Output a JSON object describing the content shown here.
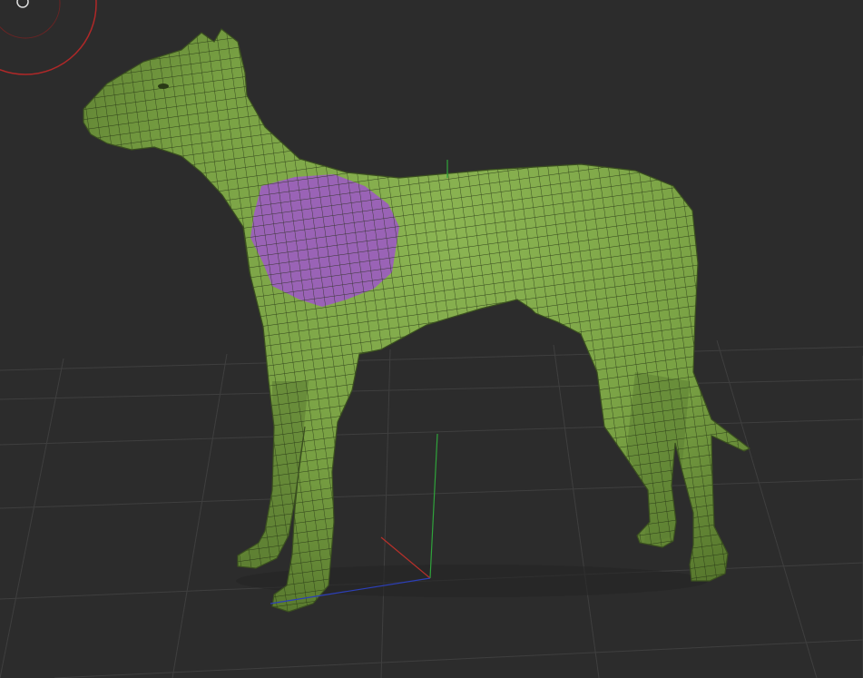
{
  "viewport": {
    "model_name": "dog-mesh",
    "colors": {
      "background": "#2c2c2c",
      "grid": "#3d3d3d",
      "model_fill": "#7fa84a",
      "model_shadow": "#4f6b2b",
      "wireframe": "#1d2a10",
      "polygroup_highlight": "#9a63b6",
      "axis_x": "#b8302a",
      "axis_y": "#2fa33b",
      "axis_z": "#2c3fb8",
      "brush_ring": "#b02828"
    },
    "gizmo": {
      "axes": [
        "x",
        "y",
        "z"
      ]
    }
  }
}
